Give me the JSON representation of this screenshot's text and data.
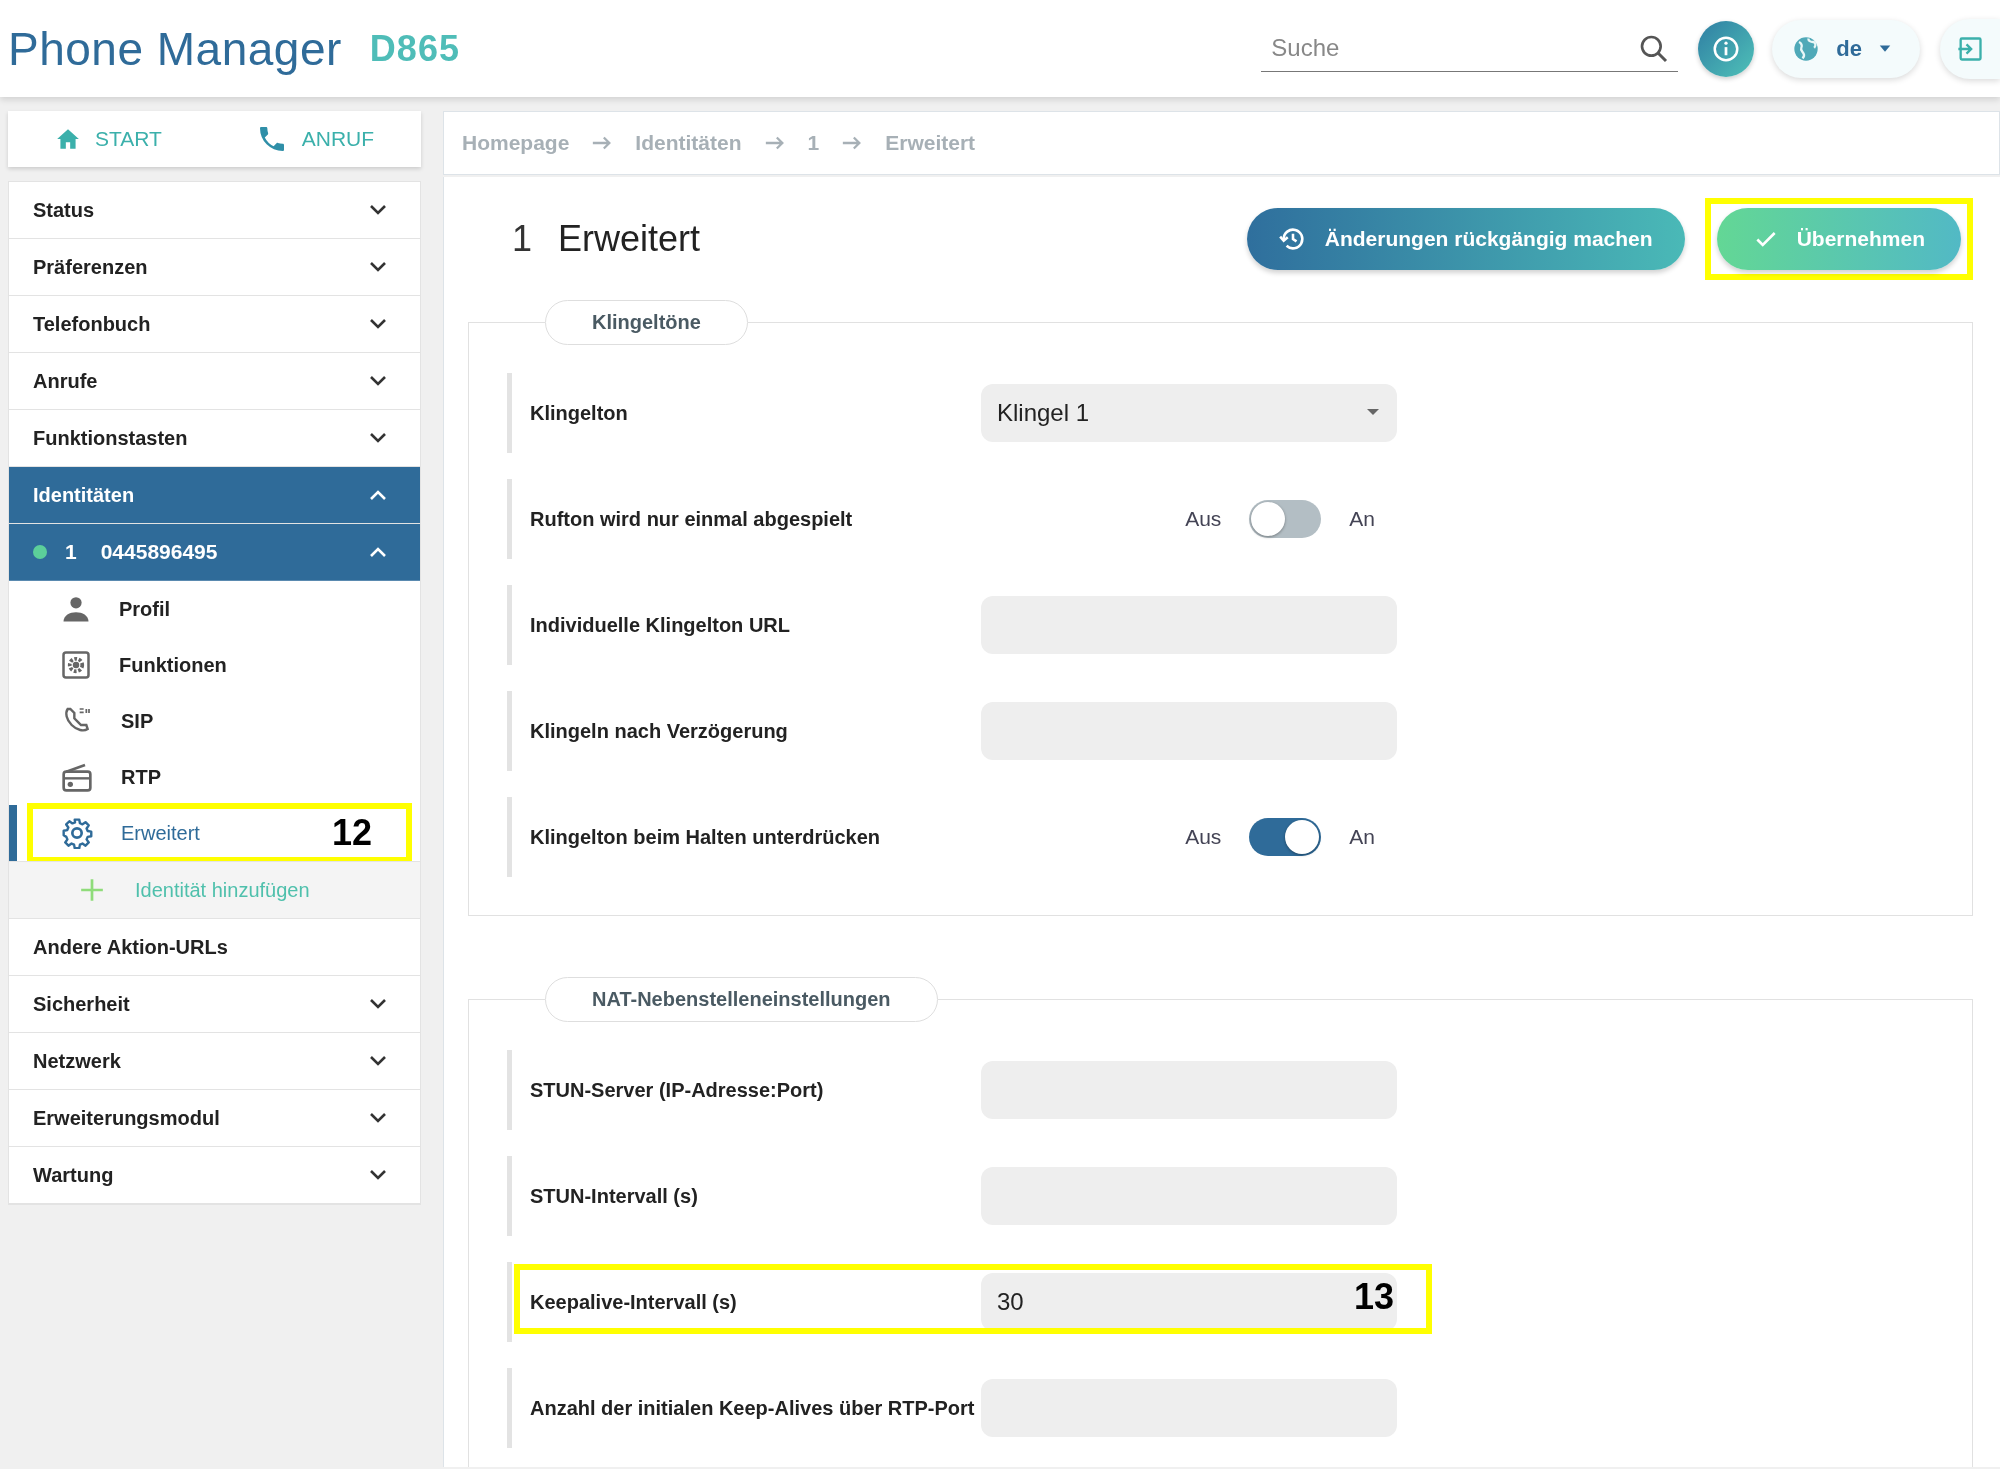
{
  "header": {
    "logo": "Phone Manager",
    "model": "D865",
    "search": {
      "placeholder": "Suche"
    },
    "language": "de"
  },
  "sidebar": {
    "quick_links": [
      {
        "kind": "home",
        "label": "START"
      },
      {
        "kind": "phone",
        "label": "ANRUF"
      }
    ],
    "items": [
      {
        "kind": "group",
        "label": "Status",
        "expanded": false,
        "selected": false
      },
      {
        "kind": "group",
        "label": "Präferenzen",
        "expanded": false,
        "selected": false
      },
      {
        "kind": "group",
        "label": "Telefonbuch",
        "expanded": false,
        "selected": false
      },
      {
        "kind": "group",
        "label": "Anrufe",
        "expanded": false,
        "selected": false
      },
      {
        "kind": "group",
        "label": "Funktionstasten",
        "expanded": false,
        "selected": false
      },
      {
        "kind": "group",
        "label": "Identitäten",
        "expanded": true,
        "selected": true,
        "children": [
          {
            "kind": "identity",
            "number": "1",
            "label": "0445896495",
            "registered": true,
            "expanded": true,
            "children": [
              {
                "kind": "person",
                "label": "Profil",
                "selected": false
              },
              {
                "kind": "gearbox",
                "label": "Funktionen",
                "selected": false
              },
              {
                "kind": "sip",
                "label": "SIP",
                "selected": false
              },
              {
                "kind": "radio",
                "label": "RTP",
                "selected": false
              },
              {
                "kind": "gear",
                "label": "Erweitert",
                "selected": true,
                "callout": "12"
              }
            ]
          },
          {
            "kind": "add",
            "label": "Identität hinzufügen"
          }
        ]
      },
      {
        "kind": "link",
        "label": "Andere Aktion-URLs",
        "selected": false
      },
      {
        "kind": "group",
        "label": "Sicherheit",
        "expanded": false,
        "selected": false
      },
      {
        "kind": "group",
        "label": "Netzwerk",
        "expanded": false,
        "selected": false
      },
      {
        "kind": "group",
        "label": "Erweiterungsmodul",
        "expanded": false,
        "selected": false
      },
      {
        "kind": "group",
        "label": "Wartung",
        "expanded": false,
        "selected": false
      }
    ]
  },
  "breadcrumb": [
    "Homepage",
    "Identitäten",
    "1",
    "Erweitert"
  ],
  "page": {
    "number": "1",
    "title": "Erweitert",
    "buttons": [
      {
        "kind": "undo",
        "label": "Änderungen rückgängig machen",
        "highlighted": false
      },
      {
        "kind": "apply",
        "label": "Übernehmen",
        "highlighted": true
      }
    ]
  },
  "sections": [
    {
      "title": "Klingeltöne",
      "fields": [
        {
          "kind": "select",
          "label": "Klingelton",
          "value": "Klingel 1"
        },
        {
          "kind": "toggle",
          "label": "Rufton wird nur einmal abgespielt",
          "off_label": "Aus",
          "on_label": "An",
          "on": false
        },
        {
          "kind": "text",
          "label": "Individuelle Klingelton URL"
        },
        {
          "kind": "text",
          "label": "Klingeln nach Verzögerung"
        },
        {
          "kind": "toggle",
          "label": "Klingelton beim Halten unterdrücken",
          "off_label": "Aus",
          "on_label": "An",
          "on": true
        }
      ]
    },
    {
      "title": "NAT-Nebenstelleneinstellungen",
      "fields": [
        {
          "kind": "text",
          "label": "STUN-Server (IP-Adresse:Port)"
        },
        {
          "kind": "text",
          "label": "STUN-Intervall (s)"
        },
        {
          "kind": "text",
          "label": "Keepalive-Intervall (s)",
          "value": "30",
          "callout": "13"
        },
        {
          "kind": "text",
          "label": "Anzahl der initialen Keep-Alives über RTP-Port"
        }
      ]
    }
  ]
}
